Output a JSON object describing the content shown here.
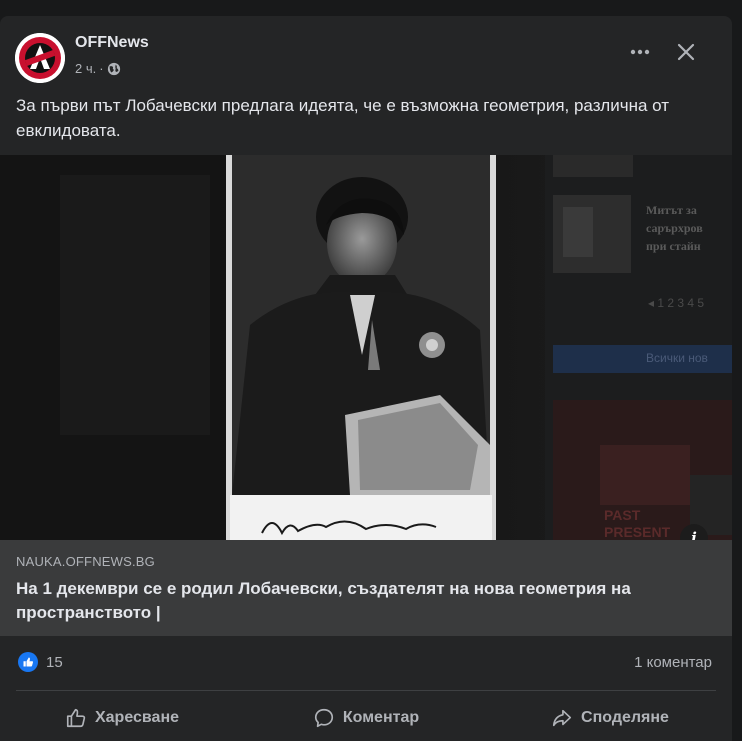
{
  "post": {
    "page_name": "OFFNews",
    "time": "2 ч.",
    "meta_separator": "·",
    "privacy_icon": "globe-icon",
    "text": "За първи път Лобачевски предлага идеята, че е възможна геометрия, различна от евклидовата.",
    "more_icon": "more-options-icon",
    "close_icon": "close-icon"
  },
  "link": {
    "domain": "NAUKA.OFFNEWS.BG",
    "title": "На 1 декември се е родил Лобачевски, създателят на нова геометрия на пространството |",
    "info_icon": "info-icon"
  },
  "image_sidebar": {
    "lines": [
      "Митът за",
      "сарърхров",
      "при стайн"
    ],
    "pagination": "◂ 1 2 3 4 5",
    "all_news_button": "Всички нов",
    "banner": [
      "PAST",
      "PRESENT"
    ]
  },
  "stats": {
    "reactions_count": "15",
    "comments": "1 коментар"
  },
  "actions": {
    "like": "Харесване",
    "comment": "Коментар",
    "share": "Споделяне"
  },
  "colors": {
    "card_bg": "#242526",
    "link_bg": "#3a3b3c",
    "accent_blue": "#1877f2",
    "text_primary": "#e4e6eb",
    "text_secondary": "#b0b3b8"
  }
}
